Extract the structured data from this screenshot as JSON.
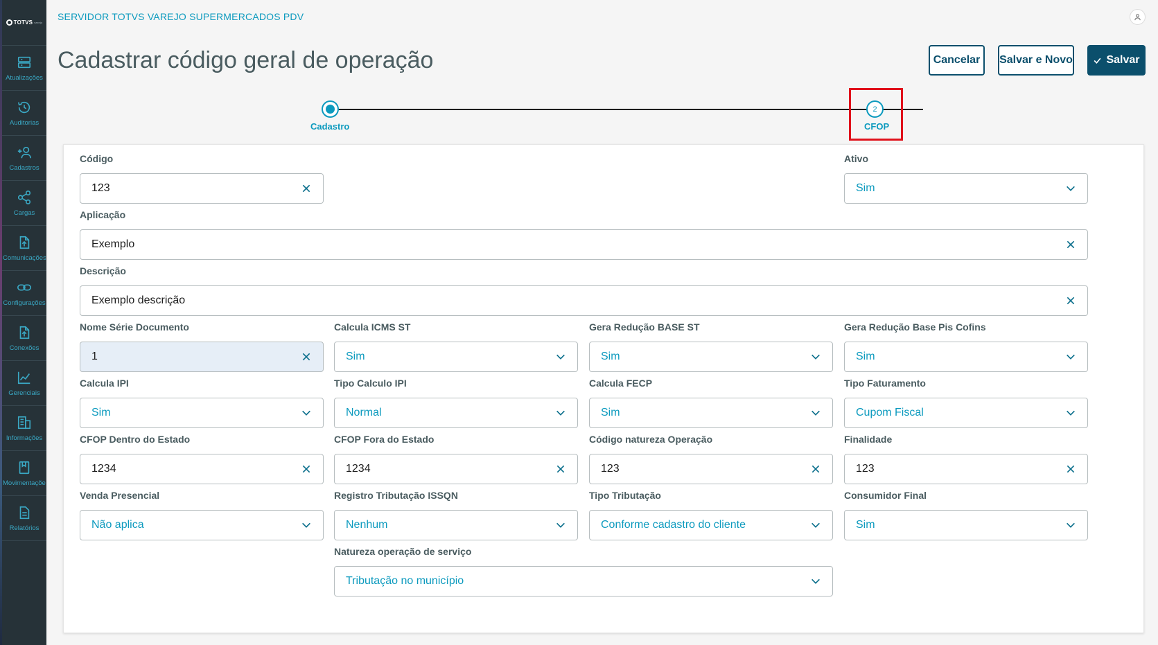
{
  "app": {
    "brand": "TOTVS",
    "brand_sub": "varejo",
    "server_title": "SERVIDOR TOTVS VAREJO SUPERMERCADOS PDV",
    "page_title": "Cadastrar código geral de operação"
  },
  "sidebar": {
    "items": [
      {
        "label": "Atualizações",
        "icon": "server-icon"
      },
      {
        "label": "Auditorias",
        "icon": "history-icon"
      },
      {
        "label": "Cadastros",
        "icon": "add-user-icon"
      },
      {
        "label": "Cargas",
        "icon": "share-icon"
      },
      {
        "label": "Comunicações",
        "icon": "file-upload-icon"
      },
      {
        "label": "Configurações",
        "icon": "link-icon"
      },
      {
        "label": "Conexões",
        "icon": "file-upload-icon"
      },
      {
        "label": "Gerenciais",
        "icon": "chart-icon"
      },
      {
        "label": "Informações",
        "icon": "building-icon"
      },
      {
        "label": "Movimentações",
        "icon": "bookmark-icon"
      },
      {
        "label": "Relatórios",
        "icon": "document-icon"
      }
    ]
  },
  "actions": {
    "cancel": "Cancelar",
    "save_new": "Salvar e Novo",
    "save": "Salvar"
  },
  "stepper": {
    "step1_label": "Cadastro",
    "step2_label": "CFOP",
    "step2_number": "2"
  },
  "form": {
    "codigo": {
      "label": "Código",
      "value": "123"
    },
    "ativo": {
      "label": "Ativo",
      "value": "Sim"
    },
    "aplicacao": {
      "label": "Aplicação",
      "value": "Exemplo"
    },
    "descricao": {
      "label": "Descrição",
      "value": "Exemplo descrição"
    },
    "nome_serie": {
      "label": "Nome Série Documento",
      "value": "1"
    },
    "calcula_icms_st": {
      "label": "Calcula ICMS ST",
      "value": "Sim"
    },
    "gera_reducao_base_st": {
      "label": "Gera Redução BASE ST",
      "value": "Sim"
    },
    "gera_reducao_pis_cofins": {
      "label": "Gera Redução Base Pis Cofins",
      "value": "Sim"
    },
    "calcula_ipi": {
      "label": "Calcula IPI",
      "value": "Sim"
    },
    "tipo_calculo_ipi": {
      "label": "Tipo Calculo IPI",
      "value": "Normal"
    },
    "calcula_fecp": {
      "label": "Calcula FECP",
      "value": "Sim"
    },
    "tipo_faturamento": {
      "label": "Tipo Faturamento",
      "value": "Cupom Fiscal"
    },
    "cfop_dentro": {
      "label": "CFOP Dentro do Estado",
      "value": "1234"
    },
    "cfop_fora": {
      "label": "CFOP Fora do Estado",
      "value": "1234"
    },
    "codigo_natureza": {
      "label": "Código natureza Operação",
      "value": "123"
    },
    "finalidade": {
      "label": "Finalidade",
      "value": "123"
    },
    "venda_presencial": {
      "label": "Venda Presencial",
      "value": "Não aplica"
    },
    "registro_issqn": {
      "label": "Registro Tributação ISSQN",
      "value": "Nenhum"
    },
    "tipo_tributacao": {
      "label": "Tipo Tributação",
      "value": "Conforme cadastro do cliente"
    },
    "consumidor_final": {
      "label": "Consumidor Final",
      "value": "Sim"
    },
    "natureza_servico": {
      "label": "Natureza operação de serviço",
      "value": "Tributação no município"
    }
  },
  "colors": {
    "primary": "#0b4f6c",
    "accent": "#0c9abe",
    "sidebar_bg": "#263238",
    "highlight": "#e0111b"
  }
}
